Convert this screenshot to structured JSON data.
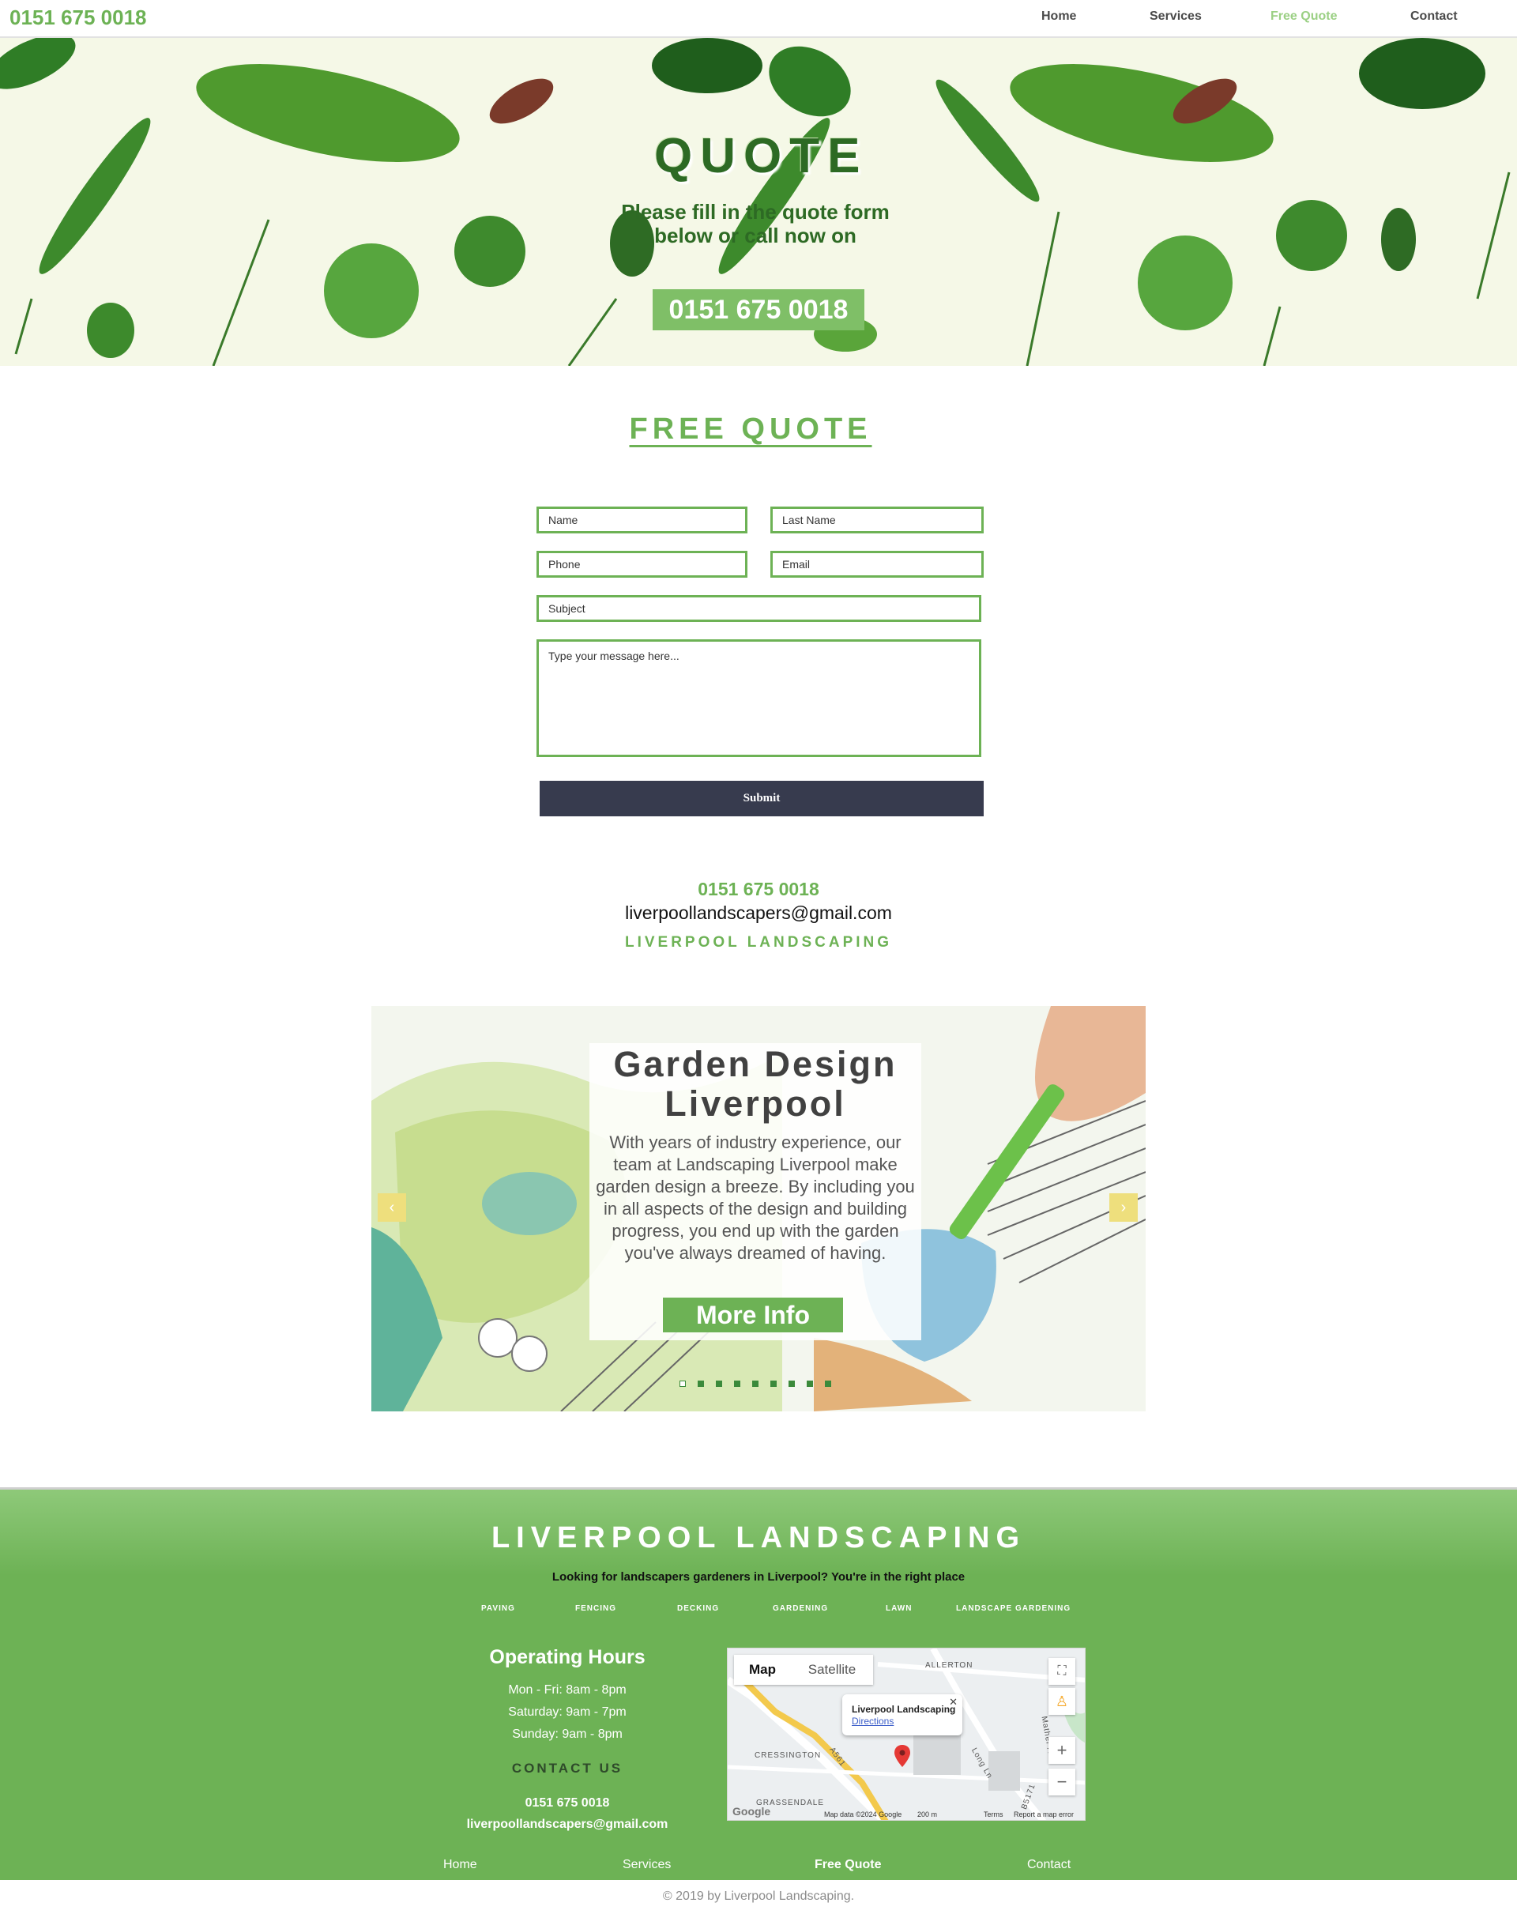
{
  "header": {
    "phone": "0151 675 0018",
    "nav": [
      "Home",
      "Services",
      "Free Quote",
      "Contact"
    ],
    "active": "Free Quote"
  },
  "hero": {
    "title": "QUOTE",
    "subtitle": "Please fill in the quote form below or call now on",
    "phone": "0151 675 0018"
  },
  "form": {
    "title": "FREE QUOTE",
    "name_placeholder": "Name",
    "last_name_placeholder": "Last Name",
    "phone_placeholder": "Phone",
    "email_placeholder": "Email",
    "subject_placeholder": "Subject",
    "message_placeholder": "Type your message here...",
    "submit": "Submit"
  },
  "contact": {
    "phone": "0151 675 0018",
    "email": "liverpoollandscapers@gmail.com",
    "brand": "LIVERPOOL LANDSCAPING"
  },
  "slider": {
    "title": "Garden Design Liverpool",
    "text": "With years of industry experience, our team at Landscaping Liverpool make garden design a breeze. By including you in all aspects of the design and building progress, you end up with the garden you've always dreamed of having.",
    "button": "More Info",
    "prev_icon": "‹",
    "next_icon": "›",
    "dot_count": 9,
    "active_dot": 0
  },
  "footer": {
    "title": "LIVERPOOL LANDSCAPING",
    "tagline": "Looking for landscapers gardeners in Liverpool? You're in the right place",
    "services": [
      "PAVING",
      "FENCING",
      "DECKING",
      "GARDENING",
      "LAWN",
      "LANDSCAPE GARDENING"
    ],
    "hours_title": "Operating Hours",
    "hours": [
      "Mon - Fri: 8am - 8pm",
      "Saturday: 9am - 7pm",
      "Sunday: 9am - 8pm"
    ],
    "contact_title": "CONTACT US",
    "phone": "0151 675 0018",
    "email": "liverpoollandscapers@gmail.com",
    "nav": [
      "Home",
      "Services",
      "Free Quote",
      "Contact"
    ],
    "active_nav": "Free Quote",
    "copyright": "© 2019 by Liverpool Landscaping."
  },
  "map": {
    "tabs": [
      "Map",
      "Satellite"
    ],
    "active_tab": "Map",
    "popup_title": "Liverpool Landscaping",
    "popup_link": "Directions",
    "labels": [
      "ALLERTON",
      "CRESSINGTON",
      "GRASSENDALE",
      "A561",
      "Long Ln",
      "Mather Ave",
      "B5171"
    ],
    "footer_items": [
      "Map data ©2024 Google",
      "200 m",
      "Terms",
      "Report a map error"
    ],
    "google": "Google"
  },
  "colors": {
    "accent": "#6db255",
    "dark_green": "#2d6a24",
    "submit_bg": "#373b4e",
    "arrow": "#eedf7d"
  }
}
